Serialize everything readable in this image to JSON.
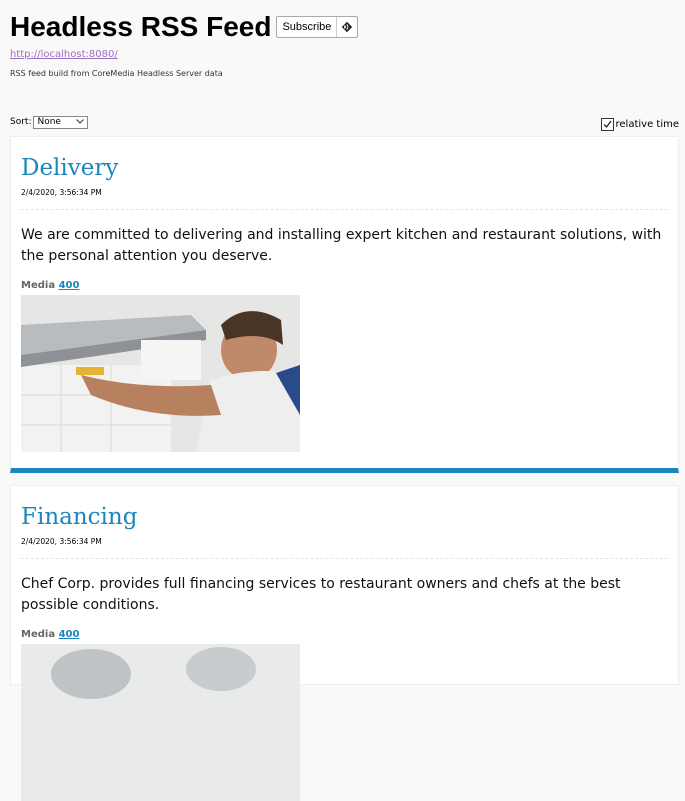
{
  "header": {
    "title": "Headless RSS Feed",
    "subscribe_label": "Subscribe",
    "url": "http://localhost:8080/",
    "description": "RSS feed build from CoreMedia Headless Server data"
  },
  "controls": {
    "sort_label": "Sort:",
    "sort_value": "None",
    "relative_time_label": "relative time",
    "relative_time_checked": true
  },
  "items": [
    {
      "title": "Delivery",
      "date": "2/4/2020, 3:56:34 PM",
      "body": "We are committed to delivering and installing expert kitchen and restaurant solutions, with the personal attention you deserve.",
      "media_label": "Media",
      "media_link": "400"
    },
    {
      "title": "Financing",
      "date": "2/4/2020, 3:56:34 PM",
      "body": "Chef Corp. provides full financing services to restaurant owners and chefs at the best possible conditions.",
      "media_label": "Media",
      "media_link": "400"
    }
  ],
  "colors": {
    "accent": "#1b86bd",
    "link_visited": "#9b6fc0"
  }
}
